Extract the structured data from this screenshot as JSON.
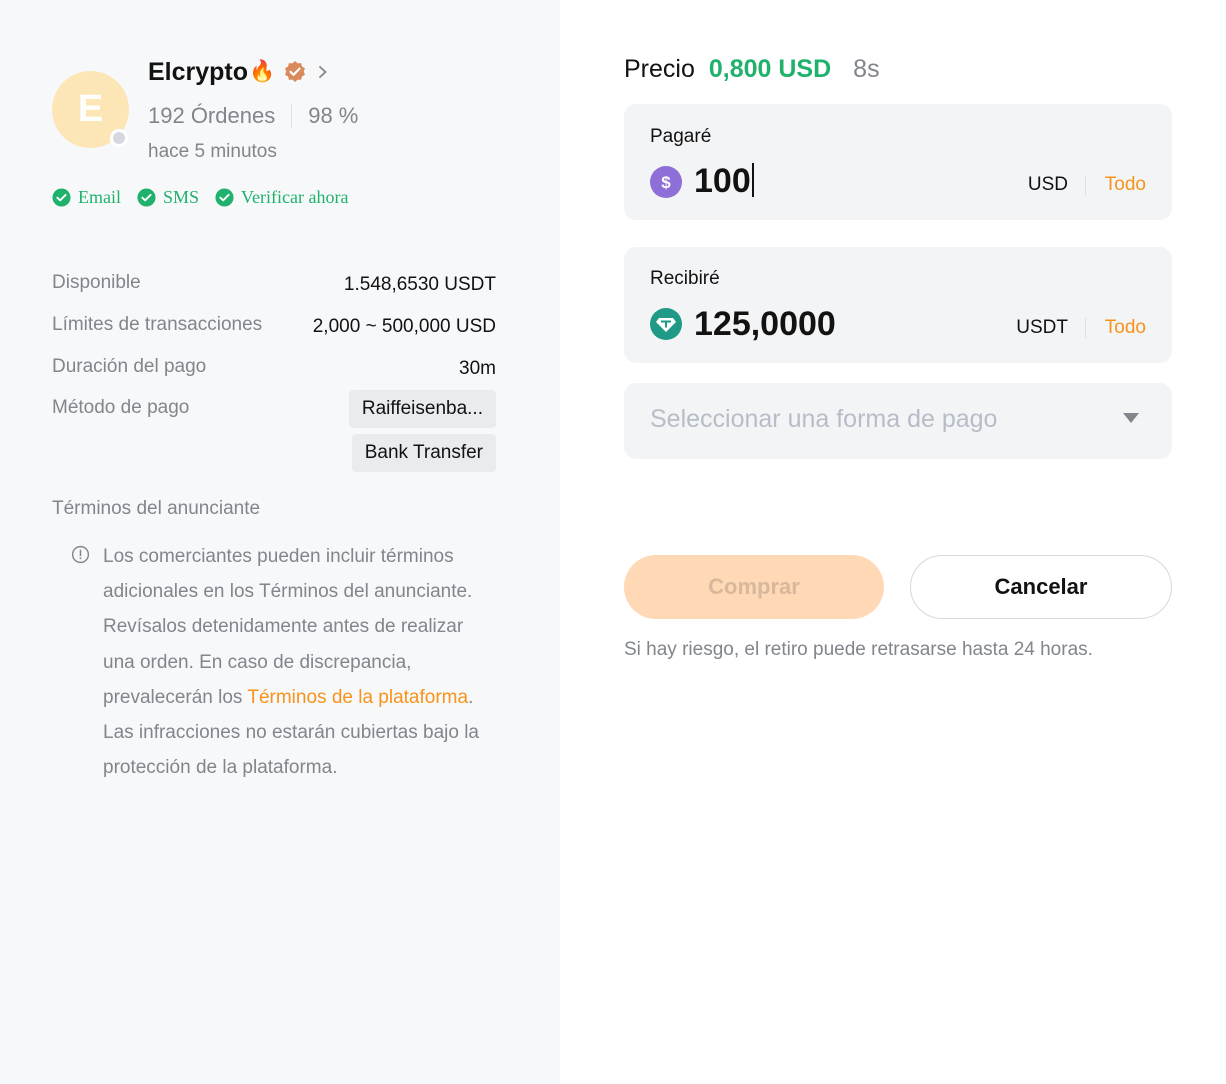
{
  "advertiser": {
    "avatar_letter": "E",
    "name": "Elcrypto",
    "name_emoji": "🔥",
    "orders": "192 Órdenes",
    "completion_rate": "98 %",
    "last_seen": "hace 5 minutos",
    "verifications": [
      "Email",
      "SMS",
      "Verificar ahora"
    ]
  },
  "details": {
    "available_label": "Disponible",
    "available_value": "1.548,6530 USDT",
    "limits_label": "Límites de transacciones",
    "limits_value": "2,000 ~ 500,000 USD",
    "duration_label": "Duración del pago",
    "duration_value": "30m",
    "method_label": "Método de pago",
    "methods": [
      "Raiffeisenba...",
      "Bank Transfer"
    ]
  },
  "terms": {
    "title": "Términos del anunciante",
    "text_before": "Los comerciantes pueden incluir términos adicionales en los Términos del anunciante. Revísalos detenidamente antes de realizar una orden. En caso de discrepancia, prevalecerán los ",
    "link": "Términos de la plataforma",
    "text_after": ". Las infracciones no estarán cubiertas bajo la protección de la plataforma."
  },
  "order": {
    "price_label": "Precio",
    "price_value": "0,800 USD",
    "timer": "8s",
    "pay": {
      "label": "Pagaré",
      "amount": "100",
      "currency": "USD",
      "max": "Todo"
    },
    "receive": {
      "label": "Recibiré",
      "amount": "125,0000",
      "currency": "USDT",
      "max": "Todo"
    },
    "payment_select_placeholder": "Seleccionar una forma de pago",
    "buy_label": "Comprar",
    "cancel_label": "Cancelar",
    "risk_note": "Si hay riesgo, el retiro puede retrasarse hasta 24 horas."
  },
  "colors": {
    "accent_orange": "#f7931a",
    "success_green": "#20b26c",
    "usd_coin": "#8e6fd8",
    "usdt_coin": "#1f9a86"
  }
}
